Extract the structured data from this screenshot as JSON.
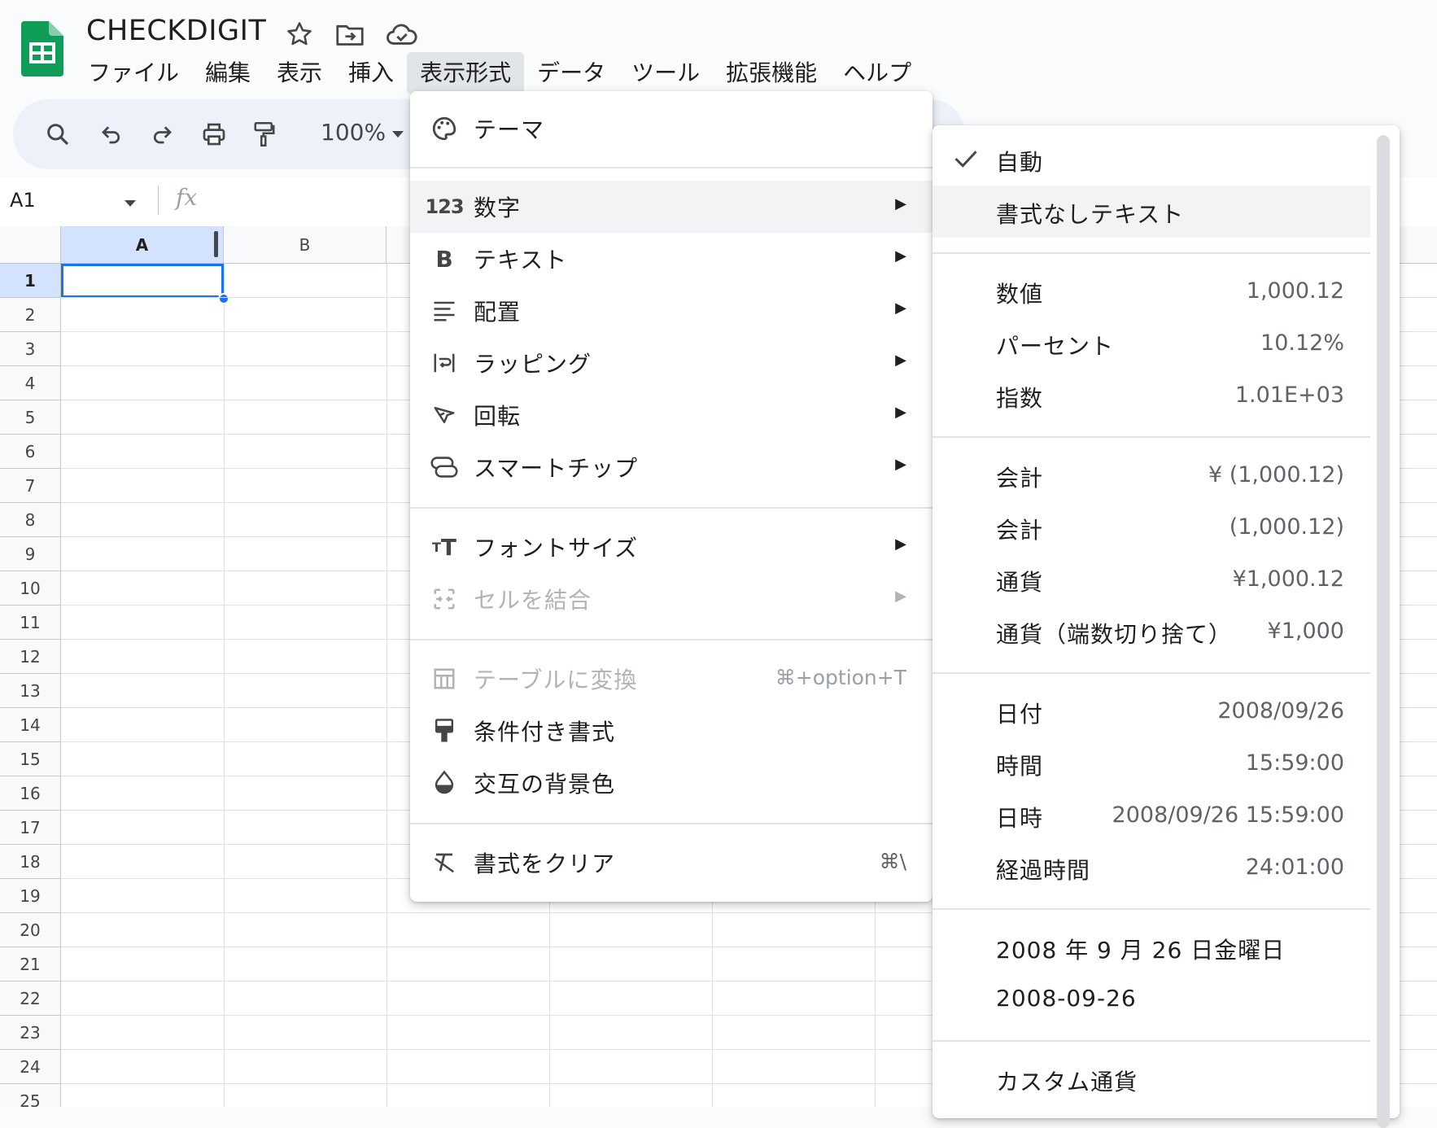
{
  "app": {
    "doc_title": "CHECKDIGIT",
    "brand_color": "#0f9d58",
    "accent_color": "#1a73e8"
  },
  "menubar": {
    "items": [
      "ファイル",
      "編集",
      "表示",
      "挿入",
      "表示形式",
      "データ",
      "ツール",
      "拡張機能",
      "ヘルプ"
    ],
    "active": "表示形式"
  },
  "toolbar": {
    "zoom": "100%",
    "icons": [
      "search-icon",
      "undo-icon",
      "redo-icon",
      "print-icon",
      "paint-format-icon"
    ]
  },
  "formula_bar": {
    "name_box": "A1",
    "fx_label": "fx"
  },
  "sheet": {
    "columns": [
      "A",
      "B"
    ],
    "rows": [
      "1",
      "2",
      "3",
      "4",
      "5",
      "6",
      "7",
      "8",
      "9",
      "10",
      "11",
      "12",
      "13",
      "14",
      "15",
      "16",
      "17",
      "18",
      "19",
      "20",
      "21",
      "22",
      "23",
      "24",
      "25"
    ],
    "selected_cell": "A1"
  },
  "format_menu": {
    "items": [
      {
        "label": "テーマ",
        "icon": "palette-icon",
        "submenu": false
      },
      {
        "label": "数字",
        "icon": "number-123-icon",
        "submenu": true,
        "highlighted": true
      },
      {
        "label": "テキスト",
        "icon": "bold-icon",
        "submenu": true
      },
      {
        "label": "配置",
        "icon": "align-icon",
        "submenu": true
      },
      {
        "label": "ラッピング",
        "icon": "wrap-icon",
        "submenu": true
      },
      {
        "label": "回転",
        "icon": "rotate-icon",
        "submenu": true
      },
      {
        "label": "スマートチップ",
        "icon": "smart-chip-icon",
        "submenu": true
      },
      {
        "label": "フォントサイズ",
        "icon": "font-size-icon",
        "submenu": true
      },
      {
        "label": "セルを結合",
        "icon": "merge-icon",
        "submenu": true,
        "disabled": true
      },
      {
        "label": "テーブルに変換",
        "icon": "table-icon",
        "shortcut": "⌘+option+T",
        "disabled": true
      },
      {
        "label": "条件付き書式",
        "icon": "conditional-format-icon"
      },
      {
        "label": "交互の背景色",
        "icon": "fill-drop-icon"
      },
      {
        "label": "書式をクリア",
        "icon": "clear-format-icon",
        "shortcut": "⌘\\"
      }
    ]
  },
  "number_menu": {
    "items": [
      {
        "label": "自動",
        "checked": true
      },
      {
        "label": "書式なしテキスト",
        "highlighted": true
      },
      {
        "label": "数値",
        "value": "1,000.12"
      },
      {
        "label": "パーセント",
        "value": "10.12%"
      },
      {
        "label": "指数",
        "value": "1.01E+03"
      },
      {
        "label": "会計",
        "value": "¥ (1,000.12)"
      },
      {
        "label": "会計",
        "value": "(1,000.12)"
      },
      {
        "label": "通貨",
        "value": "¥1,000.12"
      },
      {
        "label": "通貨（端数切り捨て）",
        "value": "¥1,000"
      },
      {
        "label": "日付",
        "value": "2008/09/26"
      },
      {
        "label": "時間",
        "value": "15:59:00"
      },
      {
        "label": "日時",
        "value": "2008/09/26 15:59:00"
      },
      {
        "label": "経過時間",
        "value": "24:01:00"
      },
      {
        "label": "2008 年 9 月 26 日金曜日"
      },
      {
        "label": "2008-09-26"
      },
      {
        "label": "カスタム通貨"
      }
    ]
  }
}
